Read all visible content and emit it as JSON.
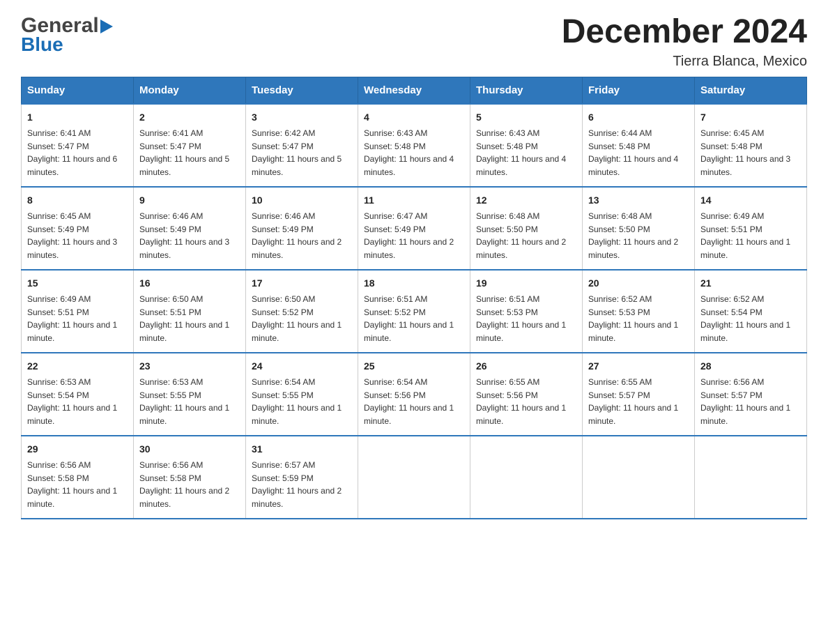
{
  "header": {
    "logo_general": "General",
    "logo_blue": "Blue",
    "title": "December 2024",
    "location": "Tierra Blanca, Mexico"
  },
  "weekdays": [
    "Sunday",
    "Monday",
    "Tuesday",
    "Wednesday",
    "Thursday",
    "Friday",
    "Saturday"
  ],
  "weeks": [
    [
      {
        "day": "1",
        "sunrise": "6:41 AM",
        "sunset": "5:47 PM",
        "daylight": "11 hours and 6 minutes."
      },
      {
        "day": "2",
        "sunrise": "6:41 AM",
        "sunset": "5:47 PM",
        "daylight": "11 hours and 5 minutes."
      },
      {
        "day": "3",
        "sunrise": "6:42 AM",
        "sunset": "5:47 PM",
        "daylight": "11 hours and 5 minutes."
      },
      {
        "day": "4",
        "sunrise": "6:43 AM",
        "sunset": "5:48 PM",
        "daylight": "11 hours and 4 minutes."
      },
      {
        "day": "5",
        "sunrise": "6:43 AM",
        "sunset": "5:48 PM",
        "daylight": "11 hours and 4 minutes."
      },
      {
        "day": "6",
        "sunrise": "6:44 AM",
        "sunset": "5:48 PM",
        "daylight": "11 hours and 4 minutes."
      },
      {
        "day": "7",
        "sunrise": "6:45 AM",
        "sunset": "5:48 PM",
        "daylight": "11 hours and 3 minutes."
      }
    ],
    [
      {
        "day": "8",
        "sunrise": "6:45 AM",
        "sunset": "5:49 PM",
        "daylight": "11 hours and 3 minutes."
      },
      {
        "day": "9",
        "sunrise": "6:46 AM",
        "sunset": "5:49 PM",
        "daylight": "11 hours and 3 minutes."
      },
      {
        "day": "10",
        "sunrise": "6:46 AM",
        "sunset": "5:49 PM",
        "daylight": "11 hours and 2 minutes."
      },
      {
        "day": "11",
        "sunrise": "6:47 AM",
        "sunset": "5:49 PM",
        "daylight": "11 hours and 2 minutes."
      },
      {
        "day": "12",
        "sunrise": "6:48 AM",
        "sunset": "5:50 PM",
        "daylight": "11 hours and 2 minutes."
      },
      {
        "day": "13",
        "sunrise": "6:48 AM",
        "sunset": "5:50 PM",
        "daylight": "11 hours and 2 minutes."
      },
      {
        "day": "14",
        "sunrise": "6:49 AM",
        "sunset": "5:51 PM",
        "daylight": "11 hours and 1 minute."
      }
    ],
    [
      {
        "day": "15",
        "sunrise": "6:49 AM",
        "sunset": "5:51 PM",
        "daylight": "11 hours and 1 minute."
      },
      {
        "day": "16",
        "sunrise": "6:50 AM",
        "sunset": "5:51 PM",
        "daylight": "11 hours and 1 minute."
      },
      {
        "day": "17",
        "sunrise": "6:50 AM",
        "sunset": "5:52 PM",
        "daylight": "11 hours and 1 minute."
      },
      {
        "day": "18",
        "sunrise": "6:51 AM",
        "sunset": "5:52 PM",
        "daylight": "11 hours and 1 minute."
      },
      {
        "day": "19",
        "sunrise": "6:51 AM",
        "sunset": "5:53 PM",
        "daylight": "11 hours and 1 minute."
      },
      {
        "day": "20",
        "sunrise": "6:52 AM",
        "sunset": "5:53 PM",
        "daylight": "11 hours and 1 minute."
      },
      {
        "day": "21",
        "sunrise": "6:52 AM",
        "sunset": "5:54 PM",
        "daylight": "11 hours and 1 minute."
      }
    ],
    [
      {
        "day": "22",
        "sunrise": "6:53 AM",
        "sunset": "5:54 PM",
        "daylight": "11 hours and 1 minute."
      },
      {
        "day": "23",
        "sunrise": "6:53 AM",
        "sunset": "5:55 PM",
        "daylight": "11 hours and 1 minute."
      },
      {
        "day": "24",
        "sunrise": "6:54 AM",
        "sunset": "5:55 PM",
        "daylight": "11 hours and 1 minute."
      },
      {
        "day": "25",
        "sunrise": "6:54 AM",
        "sunset": "5:56 PM",
        "daylight": "11 hours and 1 minute."
      },
      {
        "day": "26",
        "sunrise": "6:55 AM",
        "sunset": "5:56 PM",
        "daylight": "11 hours and 1 minute."
      },
      {
        "day": "27",
        "sunrise": "6:55 AM",
        "sunset": "5:57 PM",
        "daylight": "11 hours and 1 minute."
      },
      {
        "day": "28",
        "sunrise": "6:56 AM",
        "sunset": "5:57 PM",
        "daylight": "11 hours and 1 minute."
      }
    ],
    [
      {
        "day": "29",
        "sunrise": "6:56 AM",
        "sunset": "5:58 PM",
        "daylight": "11 hours and 1 minute."
      },
      {
        "day": "30",
        "sunrise": "6:56 AM",
        "sunset": "5:58 PM",
        "daylight": "11 hours and 2 minutes."
      },
      {
        "day": "31",
        "sunrise": "6:57 AM",
        "sunset": "5:59 PM",
        "daylight": "11 hours and 2 minutes."
      },
      null,
      null,
      null,
      null
    ]
  ],
  "labels": {
    "sunrise": "Sunrise:",
    "sunset": "Sunset:",
    "daylight": "Daylight:"
  }
}
